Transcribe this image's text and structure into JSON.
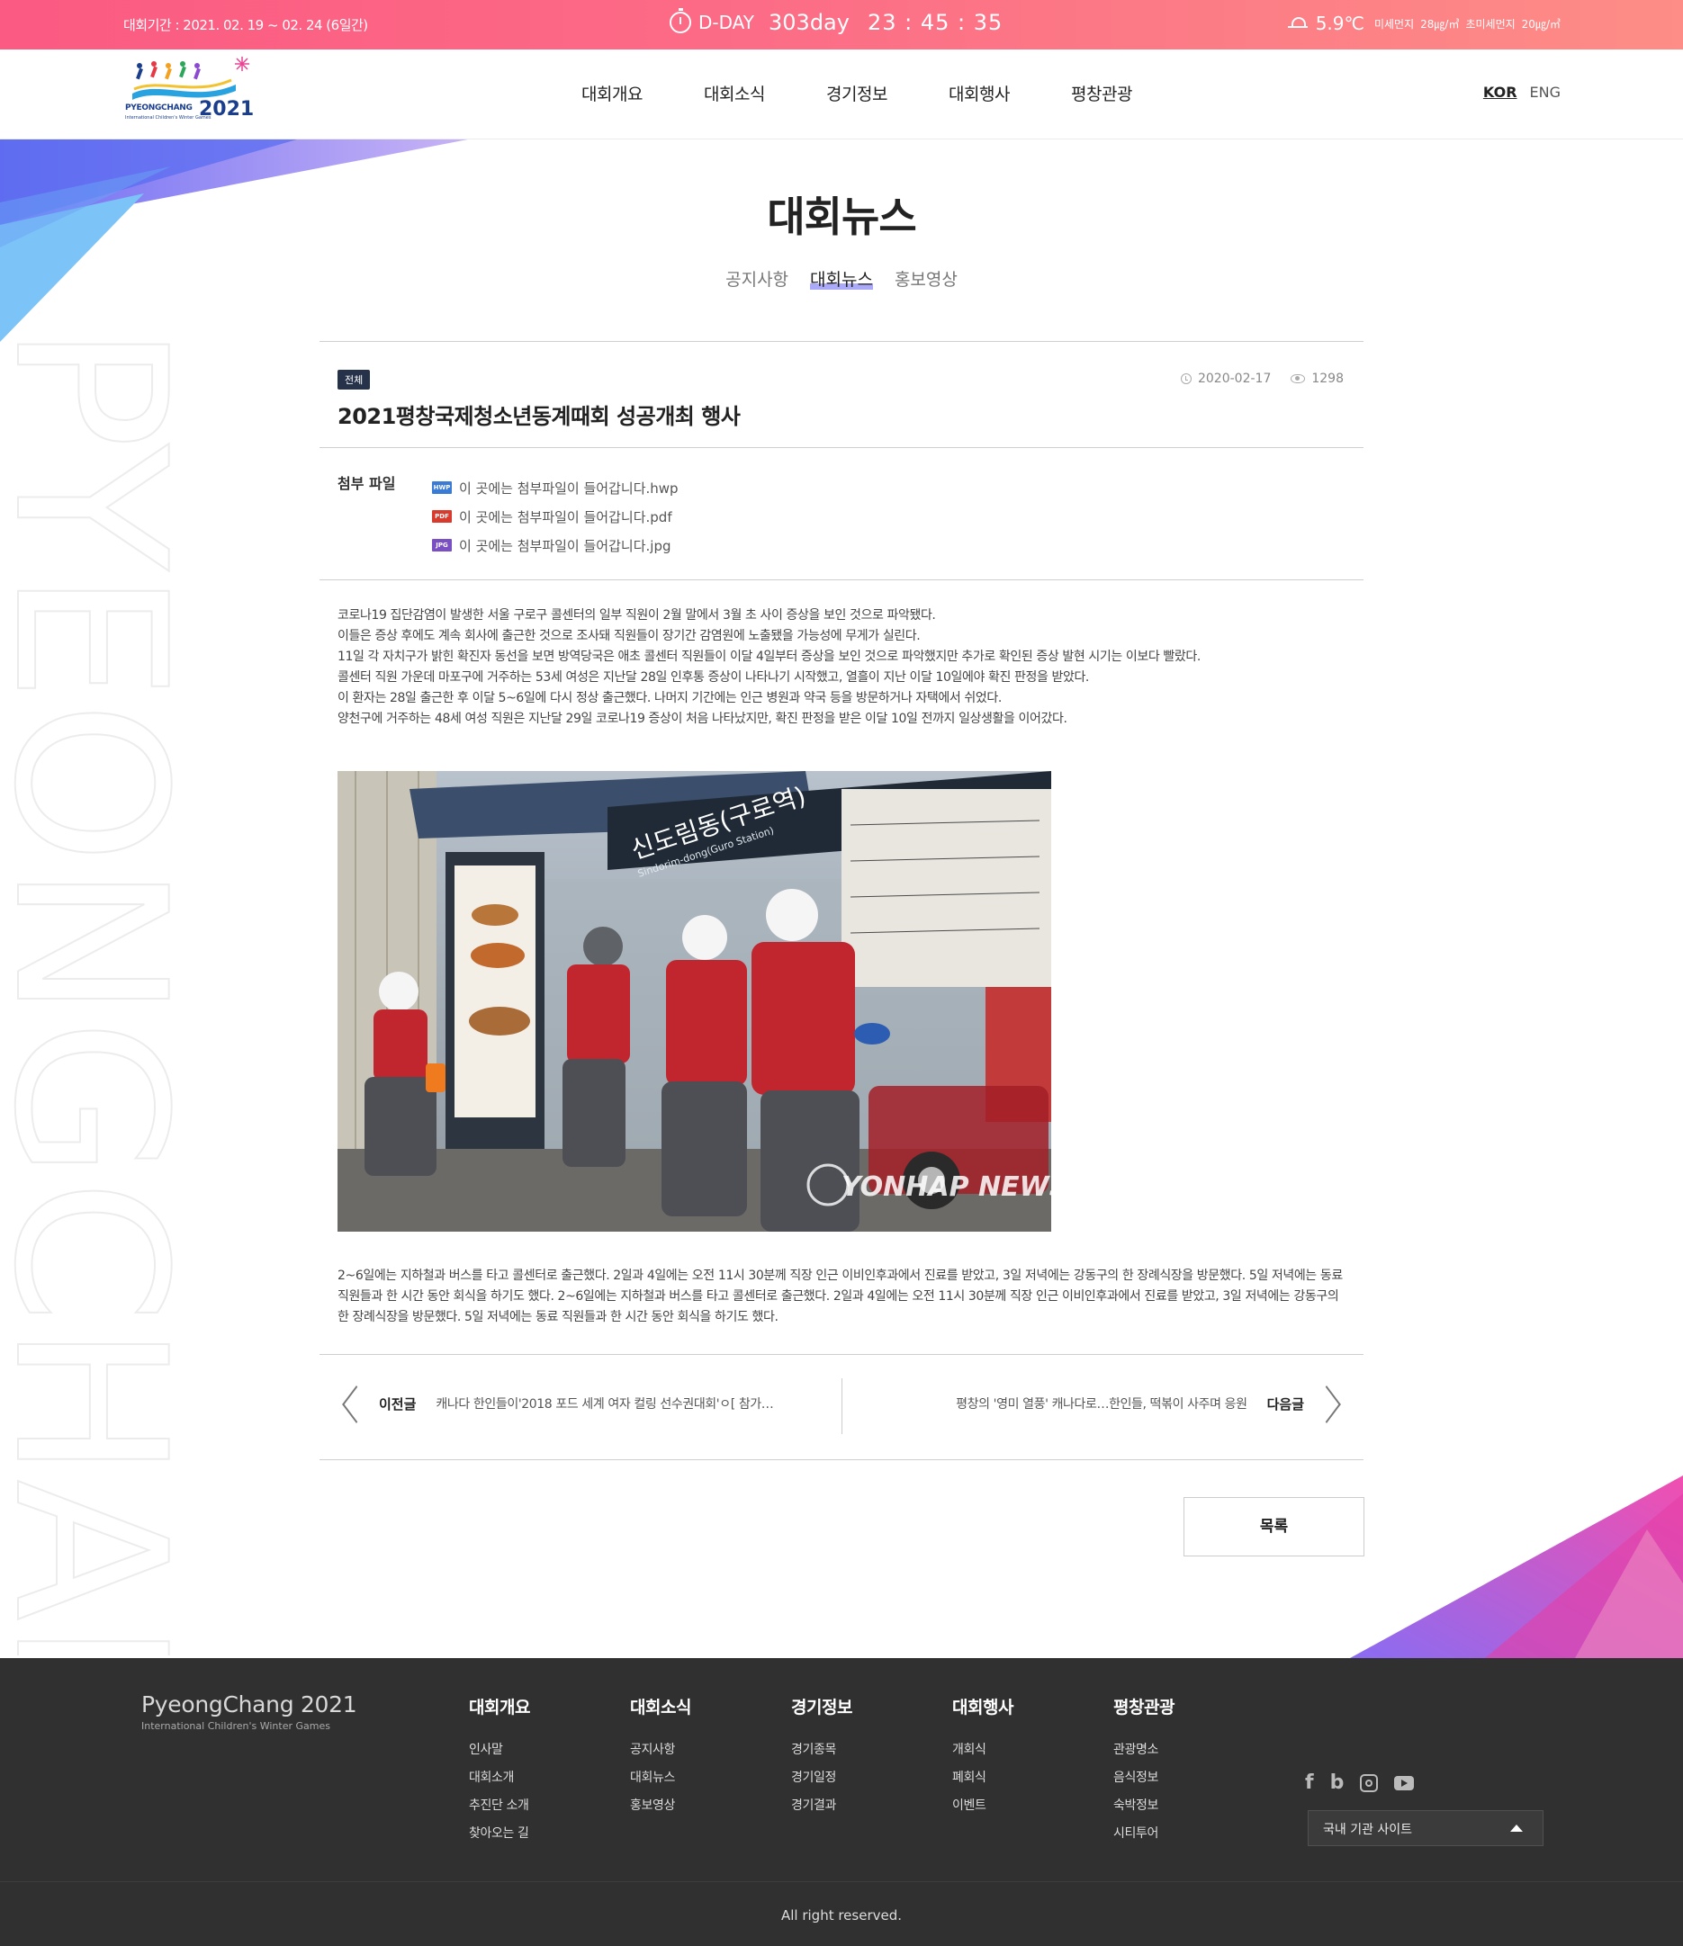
{
  "topbar": {
    "period": "대회기간 : 2021. 02. 19 ~ 02. 24 (6일간)",
    "dday_label": "D-DAY",
    "dday_days": "303day",
    "dday_clock": "23 : 45 : 35",
    "temperature": "5.9℃",
    "dust_label": "미세먼지",
    "dust_value": "28㎍/㎥",
    "ultrafine_label": "초미세먼지",
    "ultrafine_value": "20㎍/㎥"
  },
  "header": {
    "logo": {
      "wordmark": "PYEONGCHANG",
      "year": "2021",
      "subtitle": "International Children's Winter Games"
    },
    "menu": [
      {
        "label": "대회개요"
      },
      {
        "label": "대회소식"
      },
      {
        "label": "경기정보"
      },
      {
        "label": "대회행사"
      },
      {
        "label": "평창관광"
      }
    ],
    "lang_active": "KOR",
    "lang_other": "ENG"
  },
  "page": {
    "title": "대회뉴스",
    "subtabs": [
      "공지사항",
      "대회뉴스",
      "홍보영상"
    ],
    "active_subtab": "대회뉴스",
    "background_text": "PYEONGCHANG"
  },
  "article": {
    "category": "전체",
    "title": "2021평창국제청소년동계때회 성공개최 행사",
    "date": "2020-02-17",
    "views": "1298",
    "attachments_label": "첨부 파일",
    "attachments": [
      {
        "type": "HWP",
        "name": "이 곳에는 첨부파일이 들어갑니다.hwp"
      },
      {
        "type": "PDF",
        "name": "이 곳에는 첨부파일이 들어갑니다.pdf"
      },
      {
        "type": "JPG",
        "name": "이 곳에는 첨부파일이 들어갑니다.jpg"
      }
    ],
    "paragraphs_top": [
      "코로나19 집단감염이 발생한 서울 구로구 콜센터의 일부 직원이 2월 말에서 3월 초 사이 증상을 보인 것으로 파악됐다.",
      "이들은 증상 후에도 계속 회사에 출근한 것으로 조사돼 직원들이 장기간 감염원에 노출됐을 가능성에 무게가 실린다.",
      "11일 각 자치구가 밝힌 확진자 동선을 보면 방역당국은 애초 콜센터 직원들이 이달 4일부터 증상을 보인 것으로 파악했지만 추가로 확인된 증상 발현 시기는 이보다 빨랐다.",
      "콜센터 직원 가운데 마포구에 거주하는 53세 여성은 지난달 28일 인후통 증상이 나타나기 시작했고, 열흘이 지난 이달 10일에야 확진 판정을 받았다.",
      "이 환자는 28일 출근한 후 이달 5~6일에 다시 정상 출근했다. 나머지 기간에는 인근 병원과 약국 등을 방문하거나 자택에서 쉬었다.",
      "양천구에 거주하는 48세 여성 직원은 지난달 29일 코로나19 증상이 처음 나타났지만, 확진 판정을 받은 이달 10일 전까지 일상생활을 이어갔다."
    ],
    "photo": {
      "sign_korean": "신도림동(구로역)",
      "sign_english": "Sindorim-dong(Guro Station)",
      "watermark": "YONHAP NEWS"
    },
    "paragraph_bottom": "2~6일에는 지하철과 버스를 타고 콜센터로 출근했다. 2일과 4일에는 오전 11시 30분께 직장 인근 이비인후과에서 진료를 받았고, 3일 저녁에는 강동구의 한 장례식장을 방문했다. 5일 저녁에는 동료 직원들과 한 시간 동안 회식을 하기도 했다. 2~6일에는 지하철과 버스를 타고 콜센터로 출근했다. 2일과 4일에는 오전 11시 30분께 직장 인근 이비인후과에서 진료를 받았고, 3일 저녁에는 강동구의 한 장례식장을 방문했다. 5일 저녁에는 동료 직원들과 한 시간 동안 회식을 하기도 했다."
  },
  "navigation": {
    "prev_label": "이전글",
    "prev_title": "캐나다 한인들이'2018 포드 세계 여자 컬링 선수권대회'ㅇ[ 참가…",
    "next_label": "다음글",
    "next_title": "평창의 '영미 열풍' 캐나다로…한인들, 떡볶이 사주며 응원"
  },
  "list_button": "목록",
  "footer": {
    "logo_name": "PyeongChang 2021",
    "logo_sub": "International Children's Winter Games",
    "columns": [
      {
        "title": "대회개요",
        "links": [
          "인사말",
          "대회소개",
          "추진단 소개",
          "찾아오는 길"
        ]
      },
      {
        "title": "대회소식",
        "links": [
          "공지사항",
          "대회뉴스",
          "홍보영상"
        ]
      },
      {
        "title": "경기정보",
        "links": [
          "경기종목",
          "경기일정",
          "경기결과"
        ]
      },
      {
        "title": "대회행사",
        "links": [
          "개회식",
          "폐회식",
          "이벤트"
        ]
      },
      {
        "title": "평창관광",
        "links": [
          "관광명소",
          "음식정보",
          "숙박정보",
          "시티투어"
        ]
      }
    ],
    "social": [
      "facebook-icon",
      "blog-icon",
      "instagram-icon",
      "youtube-icon"
    ],
    "site_select": "국내 기관 사이트",
    "copyright": "All right reserved."
  },
  "colors": {
    "topbar_start": "#fb5a82",
    "topbar_end": "#fd8d86",
    "footer_bg": "#303030",
    "badge_bg": "#25324a",
    "tab_highlight": "#8e8ef7"
  }
}
